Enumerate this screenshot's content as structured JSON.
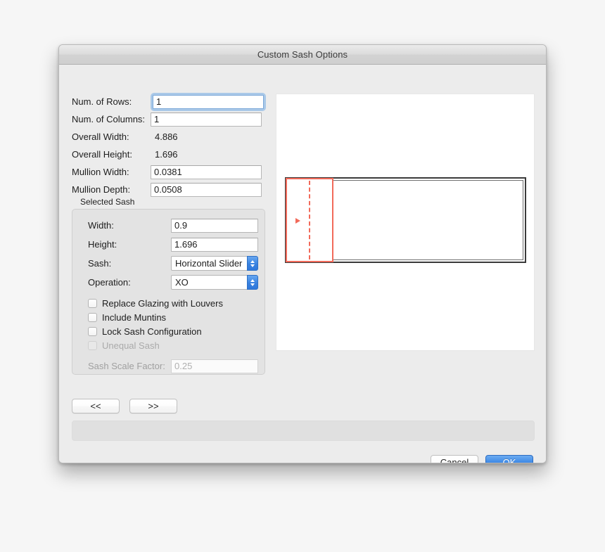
{
  "window": {
    "title": "Custom Sash Options"
  },
  "form": {
    "rows": [
      {
        "label": "Num. of Rows:",
        "value": "1",
        "type": "input",
        "focused": true
      },
      {
        "label": "Num. of Columns:",
        "value": "1",
        "type": "input",
        "focused": false
      },
      {
        "label": "Overall Width:",
        "value": "4.886",
        "type": "static"
      },
      {
        "label": "Overall Height:",
        "value": "1.696",
        "type": "static"
      },
      {
        "label": "Mullion Width:",
        "value": "0.0381",
        "type": "input",
        "focused": false
      },
      {
        "label": "Mullion Depth:",
        "value": "0.0508",
        "type": "input",
        "focused": false
      }
    ]
  },
  "selected_sash": {
    "group_title": "Selected Sash",
    "width": {
      "label": "Width:",
      "value": "0.9"
    },
    "height": {
      "label": "Height:",
      "value": "1.696"
    },
    "sash": {
      "label": "Sash:",
      "value": "Horizontal Slider"
    },
    "operation": {
      "label": "Operation:",
      "value": "XO"
    },
    "checkboxes": [
      {
        "label": "Replace Glazing with Louvers",
        "checked": false,
        "enabled": true
      },
      {
        "label": "Include Muntins",
        "checked": false,
        "enabled": true
      },
      {
        "label": "Lock Sash Configuration",
        "checked": false,
        "enabled": true
      },
      {
        "label": "Unequal Sash",
        "checked": false,
        "enabled": false
      }
    ],
    "scale_factor": {
      "label": "Sash Scale Factor:",
      "value": "0.25",
      "enabled": false
    }
  },
  "nav": {
    "prev_label": "<<",
    "next_label": ">>"
  },
  "status": {
    "text": ""
  },
  "actions": {
    "cancel_label": "Cancel",
    "ok_label": "OK"
  },
  "preview": {
    "selection_color": "#f26a5a",
    "frame_color": "#3a3a3a"
  }
}
